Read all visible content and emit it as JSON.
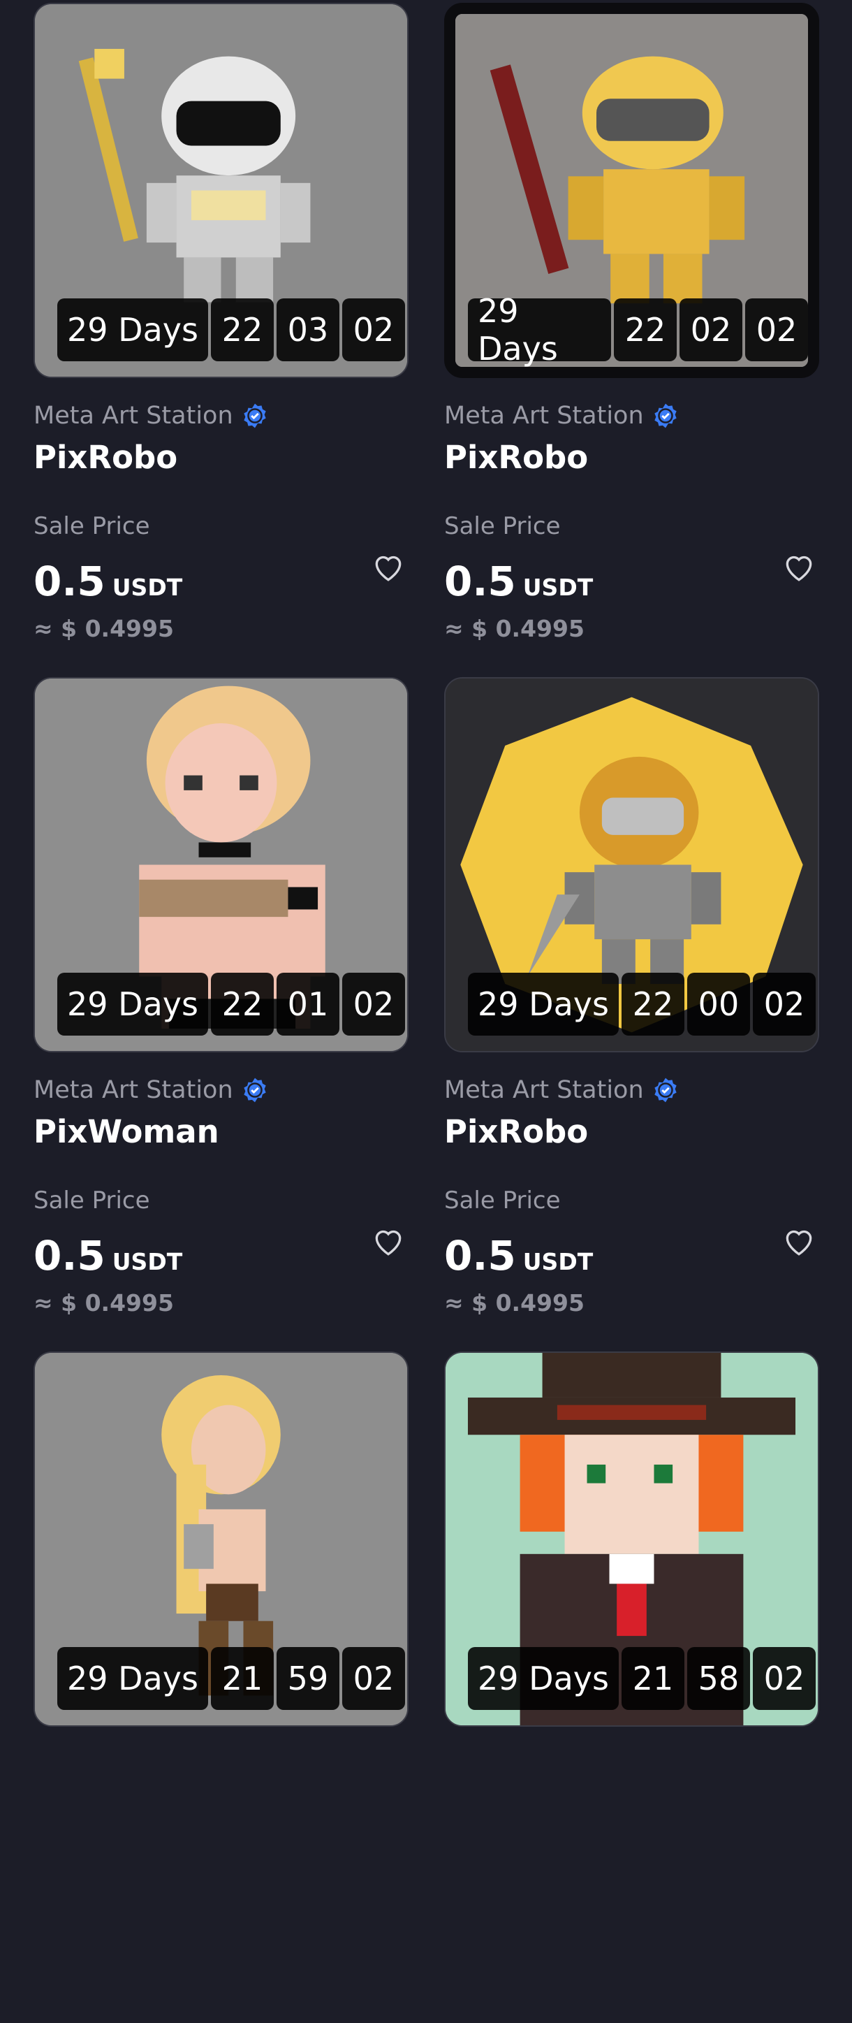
{
  "accent_color": "#3b7cf5",
  "background_color": "#1c1d28",
  "cards": [
    {
      "seller": "Meta Art Station",
      "name": "PixRobo",
      "sale_label": "Sale Price",
      "price": "0.5",
      "currency": "USDT",
      "usd": "≈ $ 0.4995",
      "timer": {
        "days": "29 Days",
        "hours": "22",
        "minutes": "03",
        "seconds": "02"
      },
      "art": "white-robot-knight-with-golden-spear"
    },
    {
      "seller": "Meta Art Station",
      "name": "PixRobo",
      "sale_label": "Sale Price",
      "price": "0.5",
      "currency": "USDT",
      "usd": "≈ $ 0.4995",
      "timer": {
        "days": "29 Days",
        "hours": "22",
        "minutes": "02",
        "seconds": "02"
      },
      "art": "yellow-robot-with-red-staff"
    },
    {
      "seller": "Meta Art Station",
      "name": "PixWoman",
      "sale_label": "Sale Price",
      "price": "0.5",
      "currency": "USDT",
      "usd": "≈ $ 0.4995",
      "timer": {
        "days": "29 Days",
        "hours": "22",
        "minutes": "01",
        "seconds": "02"
      },
      "art": "blonde-pixel-woman"
    },
    {
      "seller": "Meta Art Station",
      "name": "PixRobo",
      "sale_label": "Sale Price",
      "price": "0.5",
      "currency": "USDT",
      "usd": "≈ $ 0.4995",
      "timer": {
        "days": "29 Days",
        "hours": "22",
        "minutes": "00",
        "seconds": "02"
      },
      "art": "gold-helmet-robot-on-yellow-octagon"
    },
    {
      "seller": "",
      "name": "",
      "sale_label": "",
      "price": "",
      "currency": "",
      "usd": "",
      "timer": {
        "days": "29 Days",
        "hours": "21",
        "minutes": "59",
        "seconds": "02"
      },
      "art": "blonde-pixel-warrior-woman"
    },
    {
      "seller": "",
      "name": "",
      "sale_label": "",
      "price": "",
      "currency": "",
      "usd": "",
      "timer": {
        "days": "29 Days",
        "hours": "21",
        "minutes": "58",
        "seconds": "02"
      },
      "art": "red-haired-cowboy-hat-character"
    }
  ]
}
